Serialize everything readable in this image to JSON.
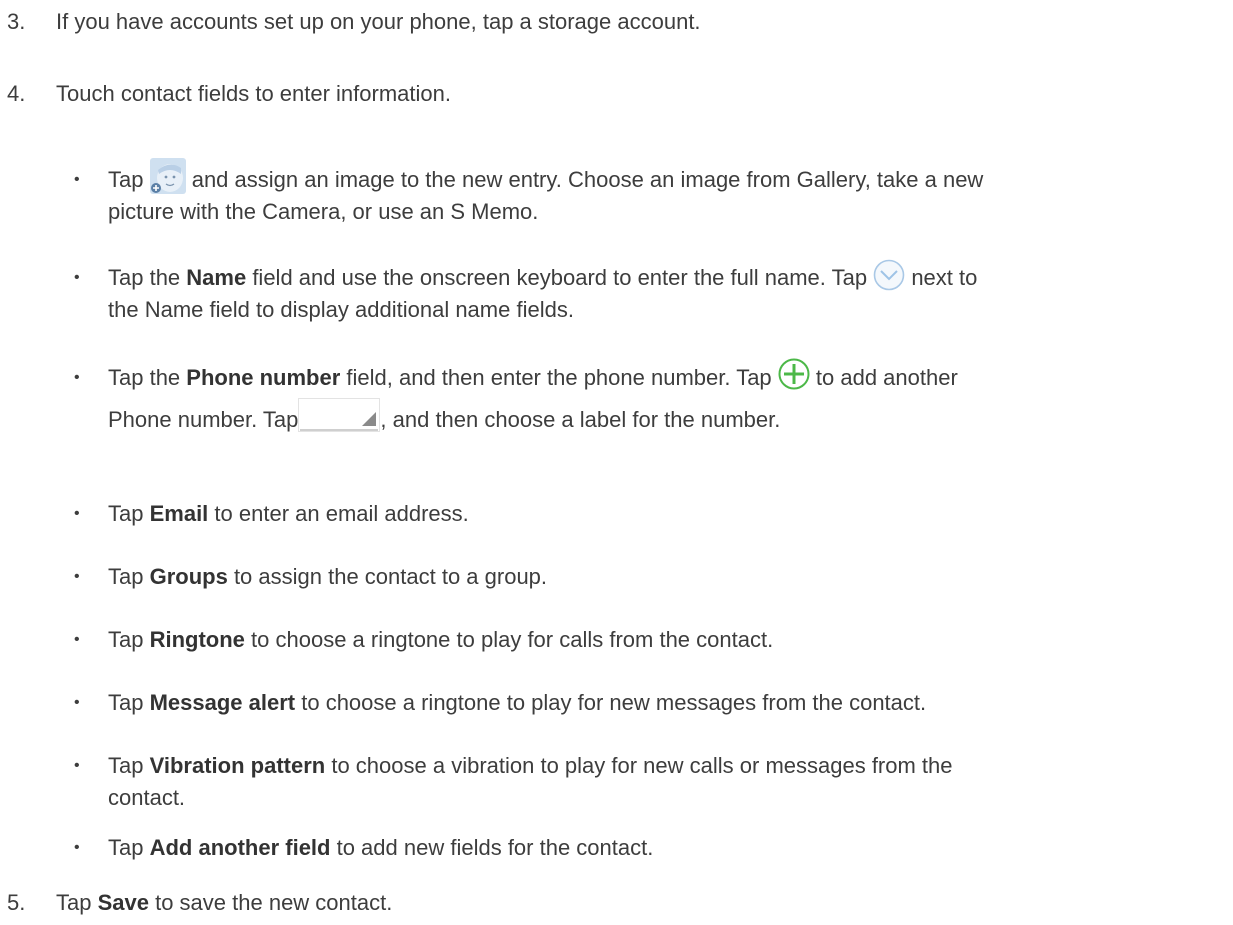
{
  "steps": {
    "s3": {
      "num": "3.",
      "text": "If you have accounts set up on your phone, tap a storage account."
    },
    "s4": {
      "num": "4.",
      "text": "Touch contact fields to enter information."
    },
    "s5": {
      "num": "5.",
      "pre": "Tap ",
      "bold": "Save",
      "post": " to save the new contact."
    }
  },
  "bullets": {
    "b1": {
      "pre": "Tap ",
      "post_line1": " and assign an image to the new entry. Choose an image from Gallery, take a new",
      "line2": "picture with the Camera, or use an S Memo."
    },
    "b2": {
      "pre": "Tap the ",
      "bold": "Name",
      "mid": " field and use the onscreen keyboard to enter the full name. Tap ",
      "post_line1": " next to",
      "line2": "the Name field to display additional name fields."
    },
    "b3": {
      "pre": "Tap the ",
      "bold": "Phone number",
      "mid": " field, and then enter the phone number. Tap ",
      "post_line1": " to add another",
      "line2_pre": "Phone number. Tap ",
      "line2_post": ", and then choose a label for the number."
    },
    "b4": {
      "pre": "Tap ",
      "bold": "Email",
      "post": " to enter an email address."
    },
    "b5": {
      "pre": "Tap ",
      "bold": "Groups",
      "post": " to assign the contact to a group."
    },
    "b6": {
      "pre": "Tap ",
      "bold": "Ringtone",
      "post": " to choose a ringtone to play for calls from the contact."
    },
    "b7": {
      "pre": "Tap ",
      "bold": "Message alert",
      "post": " to choose a ringtone to play for new messages from the contact."
    },
    "b8": {
      "pre": "Tap ",
      "bold": "Vibration pattern",
      "post_line1": " to choose a vibration to play for new calls or messages from the",
      "line2": "contact."
    },
    "b9": {
      "pre": "Tap ",
      "bold": "Add another field",
      "post": " to add new fields for the contact."
    }
  },
  "bullet_glyph": "•",
  "icons": {
    "avatar": "contact-photo-icon",
    "chevron": "chevron-down-circle-icon",
    "plus": "plus-circle-icon",
    "label": "label-dropdown-icon"
  },
  "colors": {
    "text": "#3d3d3d",
    "plus_green": "#4cb848",
    "chevron_blue": "#9ec3e6"
  }
}
